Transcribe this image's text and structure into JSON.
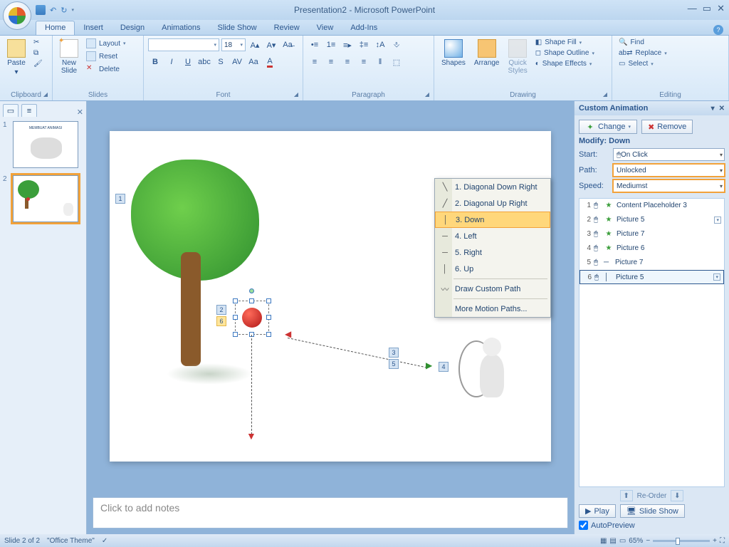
{
  "title": "Presentation2 - Microsoft PowerPoint",
  "qat": {
    "save": "Save",
    "undo": "Undo",
    "redo": "Redo"
  },
  "tabs": [
    "Home",
    "Insert",
    "Design",
    "Animations",
    "Slide Show",
    "Review",
    "View",
    "Add-Ins"
  ],
  "active_tab": "Home",
  "ribbon": {
    "clipboard": {
      "label": "Clipboard",
      "paste": "Paste"
    },
    "slides": {
      "label": "Slides",
      "new": "New\nSlide",
      "layout": "Layout",
      "reset": "Reset",
      "delete": "Delete"
    },
    "font": {
      "label": "Font",
      "family": "",
      "size": "18"
    },
    "paragraph": {
      "label": "Paragraph"
    },
    "drawing": {
      "label": "Drawing",
      "shapes": "Shapes",
      "arrange": "Arrange",
      "quick": "Quick\nStyles",
      "fill": "Shape Fill",
      "outline": "Shape Outline",
      "effects": "Shape Effects"
    },
    "editing": {
      "label": "Editing",
      "find": "Find",
      "replace": "Replace",
      "select": "Select"
    }
  },
  "slidepanel": {
    "thumbs": [
      {
        "n": "1",
        "title": "MEMBUAT ANIMASI"
      },
      {
        "n": "2",
        "title": ""
      }
    ],
    "selected": 1
  },
  "slide_tags": {
    "t1": "1",
    "t2": "2",
    "t6": "6",
    "t3": "3",
    "t5": "5",
    "t4": "4"
  },
  "ctxmenu": {
    "items": [
      {
        "g": "↘",
        "t": "1. Diagonal Down Right"
      },
      {
        "g": "↗",
        "t": "2. Diagonal Up Right"
      },
      {
        "g": "│",
        "t": "3. Down",
        "hl": true
      },
      {
        "g": "─",
        "t": "4. Left"
      },
      {
        "g": "─",
        "t": "5. Right"
      },
      {
        "g": "│",
        "t": "6. Up"
      }
    ],
    "draw": "Draw Custom Path",
    "more": "More Motion Paths..."
  },
  "notes_placeholder": "Click to add notes",
  "taskpane": {
    "title": "Custom Animation",
    "change": "Change",
    "remove": "Remove",
    "modify": "Modify: Down",
    "start_l": "Start:",
    "start_v": "On Click",
    "path_l": "Path:",
    "path_v": "Unlocked",
    "speed_l": "Speed:",
    "speed_v": "Mediumst",
    "items": [
      {
        "n": "1",
        "star": true,
        "name": "Content Placeholder 3"
      },
      {
        "n": "2",
        "star": true,
        "name": "Picture 5",
        "dd": true
      },
      {
        "n": "3",
        "star": true,
        "name": "Picture 7"
      },
      {
        "n": "4",
        "star": true,
        "name": "Picture 6"
      },
      {
        "n": "5",
        "star": false,
        "name": "Picture 7"
      },
      {
        "n": "6",
        "star": false,
        "name": "Picture 5",
        "sel": true,
        "dd": true
      }
    ],
    "reorder": "Re-Order",
    "play": "Play",
    "slideshow": "Slide Show",
    "autoprev": "AutoPreview"
  },
  "status": {
    "slide": "Slide 2 of 2",
    "theme": "\"Office Theme\"",
    "zoom": "65%"
  }
}
